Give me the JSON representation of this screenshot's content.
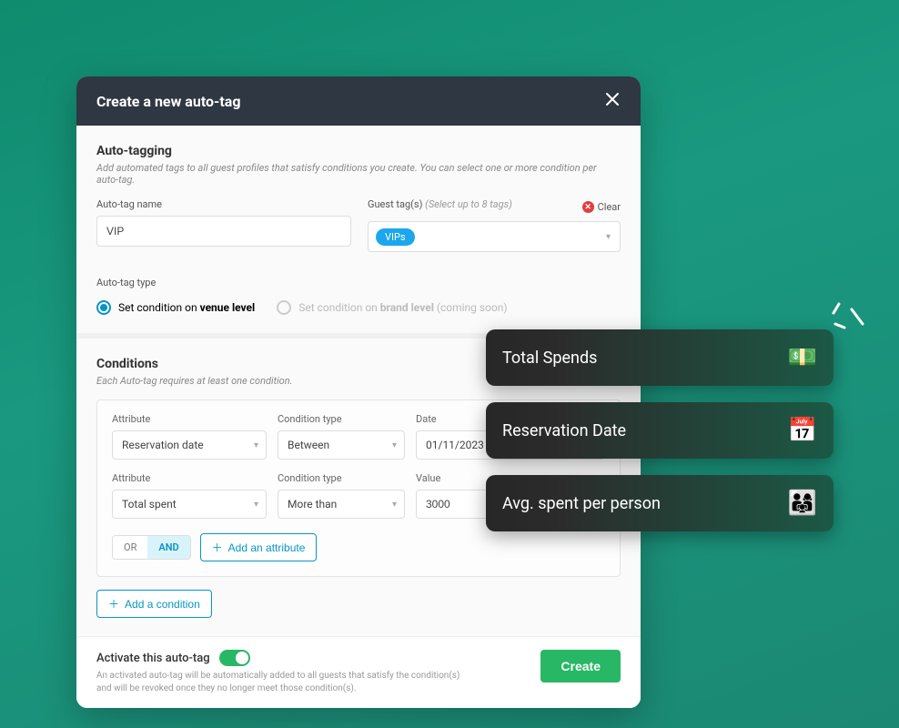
{
  "modal": {
    "title": "Create a new auto-tag",
    "autotagging": {
      "heading": "Auto-tagging",
      "desc": "Add automated tags to all guest profiles that satisfy conditions you create. You can select one or more condition per auto-tag.",
      "name_label": "Auto-tag name",
      "name_value": "VIP",
      "tags_label": "Guest tag(s)",
      "tags_hint": "(Select up to 8 tags)",
      "tags_selected": "VIPs",
      "clear_label": "Clear"
    },
    "type": {
      "label": "Auto-tag type",
      "opt1_prefix": "Set condition on ",
      "opt1_bold": "venue level",
      "opt2_prefix": "Set condition on ",
      "opt2_bold": "brand level",
      "opt2_suffix": " (coming soon)"
    },
    "conditions": {
      "heading": "Conditions",
      "desc": "Each Auto-tag requires at least one condition.",
      "attribute_label": "Attribute",
      "condtype_label": "Condition type",
      "date_label": "Date",
      "value_label": "Value",
      "row1_attr": "Reservation date",
      "row1_cond": "Between",
      "row1_date": "01/11/2023 ~",
      "row2_attr": "Total spent",
      "row2_cond": "More than",
      "row2_value": "3000",
      "or_label": "OR",
      "and_label": "AND",
      "add_attr": "Add an attribute",
      "add_cond": "Add a condition"
    },
    "footer": {
      "activate_title": "Activate this auto-tag",
      "activate_desc": "An activated auto-tag will be automatically added to all guests that satisfy the condition(s) and will be revoked once they no longer meet those condition(s).",
      "create": "Create"
    }
  },
  "chips": {
    "c1": {
      "label": "Total Spends",
      "emoji": "💵"
    },
    "c2": {
      "label": "Reservation Date",
      "emoji": "📅"
    },
    "c3": {
      "label": "Avg. spent per person",
      "emoji": "👨‍👩‍👧"
    }
  }
}
